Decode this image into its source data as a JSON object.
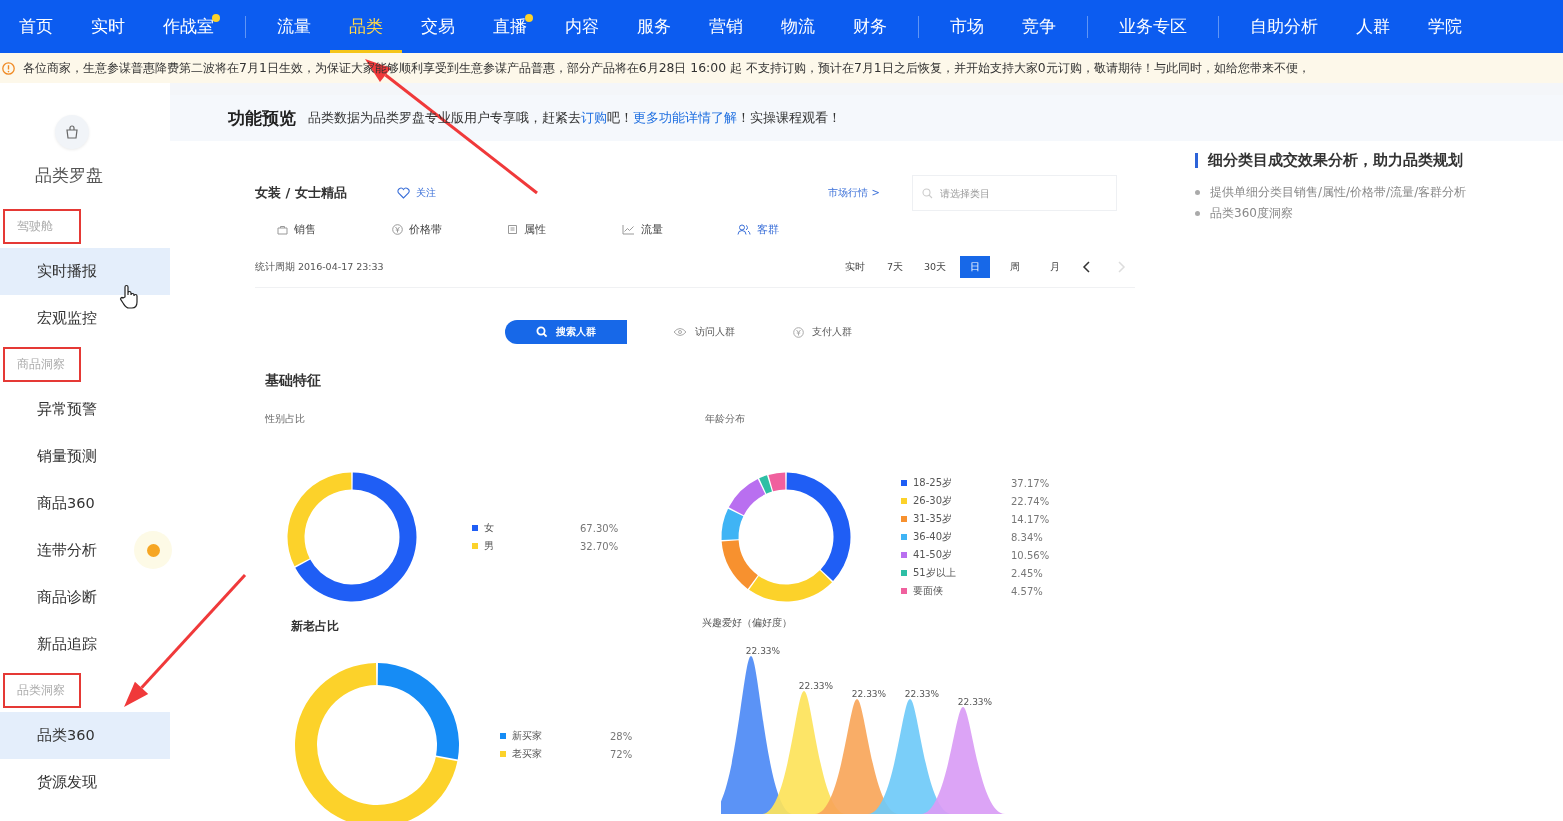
{
  "nav": {
    "groups": [
      {
        "items": [
          {
            "label": "首页",
            "selected": false,
            "dot": false
          },
          {
            "label": "实时",
            "selected": false,
            "dot": false
          },
          {
            "label": "作战室",
            "selected": false,
            "dot": true
          }
        ]
      },
      {
        "items": [
          {
            "label": "流量",
            "selected": false,
            "dot": false
          },
          {
            "label": "品类",
            "selected": true,
            "dot": false
          },
          {
            "label": "交易",
            "selected": false,
            "dot": false
          },
          {
            "label": "直播",
            "selected": false,
            "dot": true
          },
          {
            "label": "内容",
            "selected": false,
            "dot": false
          },
          {
            "label": "服务",
            "selected": false,
            "dot": false
          },
          {
            "label": "营销",
            "selected": false,
            "dot": false
          },
          {
            "label": "物流",
            "selected": false,
            "dot": false
          },
          {
            "label": "财务",
            "selected": false,
            "dot": false
          }
        ]
      },
      {
        "items": [
          {
            "label": "市场",
            "selected": false,
            "dot": false
          },
          {
            "label": "竞争",
            "selected": false,
            "dot": false
          }
        ]
      },
      {
        "items": [
          {
            "label": "业务专区",
            "selected": false,
            "dot": false
          }
        ]
      },
      {
        "items": [
          {
            "label": "自助分析",
            "selected": false,
            "dot": false
          },
          {
            "label": "人群",
            "selected": false,
            "dot": false
          },
          {
            "label": "学院",
            "selected": false,
            "dot": false
          }
        ]
      }
    ]
  },
  "notice": "各位商家，生意参谋普惠降费第二波将在7月1日生效，为保证大家能够顺利享受到生意参谋产品普惠，部分产品将在6月28日 16:00 起 不支持订购，预计在7月1日之后恢复，并开始支持大家0元订购，敬请期待！与此同时，如给您带来不便，",
  "sidebar": {
    "title": "品类罗盘",
    "groups": [
      {
        "label": "驾驶舱",
        "boxed": true,
        "items": [
          {
            "label": "实时播报",
            "selected": true,
            "dot": false
          },
          {
            "label": "宏观监控",
            "selected": false,
            "dot": false
          }
        ]
      },
      {
        "label": "商品洞察",
        "boxed": true,
        "items": [
          {
            "label": "异常预警",
            "selected": false,
            "dot": false
          },
          {
            "label": "销量预测",
            "selected": false,
            "dot": false
          },
          {
            "label": "商品360",
            "selected": false,
            "dot": false
          },
          {
            "label": "连带分析",
            "selected": false,
            "dot": true
          },
          {
            "label": "商品诊断",
            "selected": false,
            "dot": false
          },
          {
            "label": "新品追踪",
            "selected": false,
            "dot": false
          }
        ]
      },
      {
        "label": "品类洞察",
        "boxed": true,
        "items": [
          {
            "label": "品类360",
            "selected": true,
            "dot": false
          },
          {
            "label": "货源发现",
            "selected": false,
            "dot": false
          }
        ]
      }
    ]
  },
  "header": {
    "title": "功能预览",
    "message": [
      {
        "text": "品类数据为品类罗盘专业版用户专享哦，赶紧去",
        "link": false
      },
      {
        "text": "订购",
        "link": true
      },
      {
        "text": "吧！",
        "link": false
      },
      {
        "text": "更多功能详情了解",
        "link": true
      },
      {
        "text": "！实操课程观看！",
        "link": false
      }
    ]
  },
  "card": {
    "breadcrumb": "女装 / 女士精品",
    "follow": "关注",
    "market_link": "市场行情 >",
    "search": {
      "placeholder": "请选择类目"
    },
    "tabs": [
      {
        "label": "销售",
        "selected": false
      },
      {
        "label": "价格带",
        "selected": false
      },
      {
        "label": "属性",
        "selected": false
      },
      {
        "label": "流量",
        "selected": false
      },
      {
        "label": "客群",
        "selected": true
      }
    ],
    "period": "统计周期 2016-04-17 23:33",
    "ranges": [
      {
        "label": "实时",
        "selected": false
      },
      {
        "label": "7天",
        "selected": false
      },
      {
        "label": "30天",
        "selected": false
      },
      {
        "label": "日",
        "selected": true
      },
      {
        "label": "周",
        "selected": false
      },
      {
        "label": "月",
        "selected": false
      }
    ],
    "next_disabled": true,
    "crowds": [
      {
        "label": "搜索人群",
        "selected": true
      },
      {
        "label": "访问人群",
        "selected": false
      },
      {
        "label": "支付人群",
        "selected": false
      }
    ],
    "section": "基础特征",
    "gender": {
      "legend": [
        {
          "value": "67.30%",
          "color": "#1f5ef5"
        },
        {
          "value": "32.70%",
          "color": "#fcd22a"
        }
      ],
      "chart_data": {
        "type": "donut",
        "legend": "right",
        "title": "性别占比",
        "categories": [
          "女",
          "男"
        ],
        "values": [
          67.3,
          32.7
        ]
      }
    },
    "age": {
      "legend": [
        {
          "value": "37.17%",
          "color": "#1f5ef5"
        },
        {
          "value": "22.74%",
          "color": "#fcd22a"
        },
        {
          "value": "14.17%",
          "color": "#f7912f"
        },
        {
          "value": "8.34%",
          "color": "#3fb4f5"
        },
        {
          "value": "10.56%",
          "color": "#b96ff0"
        },
        {
          "value": "2.45%",
          "color": "#2ebfa5"
        },
        {
          "value": "4.57%",
          "color": "#f0609e"
        }
      ],
      "chart_data": {
        "type": "donut",
        "legend": "right",
        "title": "年龄分布",
        "categories": [
          "18-25岁",
          "26-30岁",
          "31-35岁",
          "36-40岁",
          "41-50岁",
          "51岁以上",
          "要面侠"
        ],
        "values": [
          37.17,
          22.74,
          14.17,
          8.34,
          10.56,
          2.45,
          4.57
        ]
      }
    },
    "buyers": {
      "legend": [
        {
          "value": "28%",
          "color": "#168cf5"
        },
        {
          "value": "72%",
          "color": "#fcd22a"
        }
      ],
      "chart_data": {
        "type": "donut",
        "legend": "right",
        "title": "新老占比",
        "categories": [
          "新买家",
          "老买家"
        ],
        "values": [
          28,
          72
        ]
      }
    },
    "interest": {
      "title": "兴趣爱好（偏好度）",
      "peaks": [
        {
          "label": "22.33%",
          "color": "#4d8af5"
        },
        {
          "label": "22.33%",
          "color": "#fde35a"
        },
        {
          "label": "22.33%",
          "color": "#f9a65a"
        },
        {
          "label": "22.33%",
          "color": "#6fcaf8"
        },
        {
          "label": "22.33%",
          "color": "#d99cf5"
        }
      ]
    }
  },
  "info": {
    "heading": "细分类目成交效果分析，助力品类规划",
    "bullets": [
      "提供单细分类目销售/属性/价格带/流量/客群分析",
      "品类360度洞察"
    ]
  }
}
